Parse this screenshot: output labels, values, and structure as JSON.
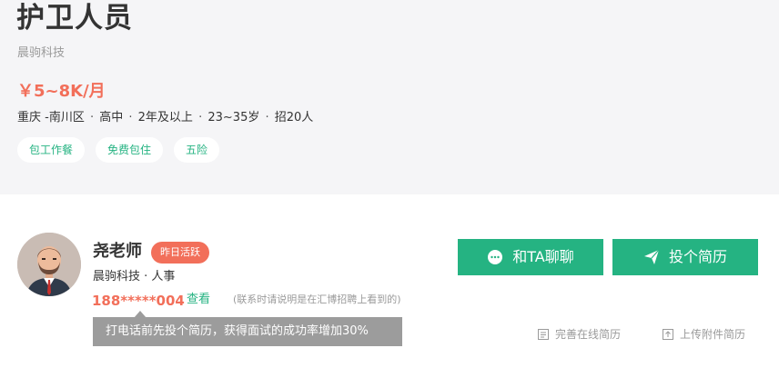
{
  "job": {
    "title": "护卫人员",
    "company": "晨驹科技",
    "salary": "￥5~8K/月",
    "requirements": [
      "重庆 -南川区",
      "高中",
      "2年及以上",
      "23~35岁",
      "招20人"
    ],
    "benefits": [
      "包工作餐",
      "免费包住",
      "五险"
    ]
  },
  "recruiter": {
    "name": "尧老师",
    "active_badge": "昨日活跃",
    "company_role": "晨驹科技 · 人事",
    "phone": "188*****004",
    "view_label": "查看",
    "contact_note": "(联系时请说明是在汇博招聘上看到的)",
    "tooltip": "打电话前先投个简历，获得面试的成功率增加30%"
  },
  "actions": {
    "chat_label": "和TA聊聊",
    "resume_label": "投个简历",
    "online_resume_label": "完善在线简历",
    "upload_resume_label": "上传附件简历"
  },
  "icons": {
    "chat": "chat-bubble-icon",
    "send": "paper-plane-icon",
    "online_resume": "document-icon",
    "upload_resume": "upload-icon"
  },
  "colors": {
    "accent_green": "#25b382",
    "accent_orange": "#f26f5a",
    "header_bg": "#f5f5f7",
    "muted_text": "#9a9a9a"
  }
}
